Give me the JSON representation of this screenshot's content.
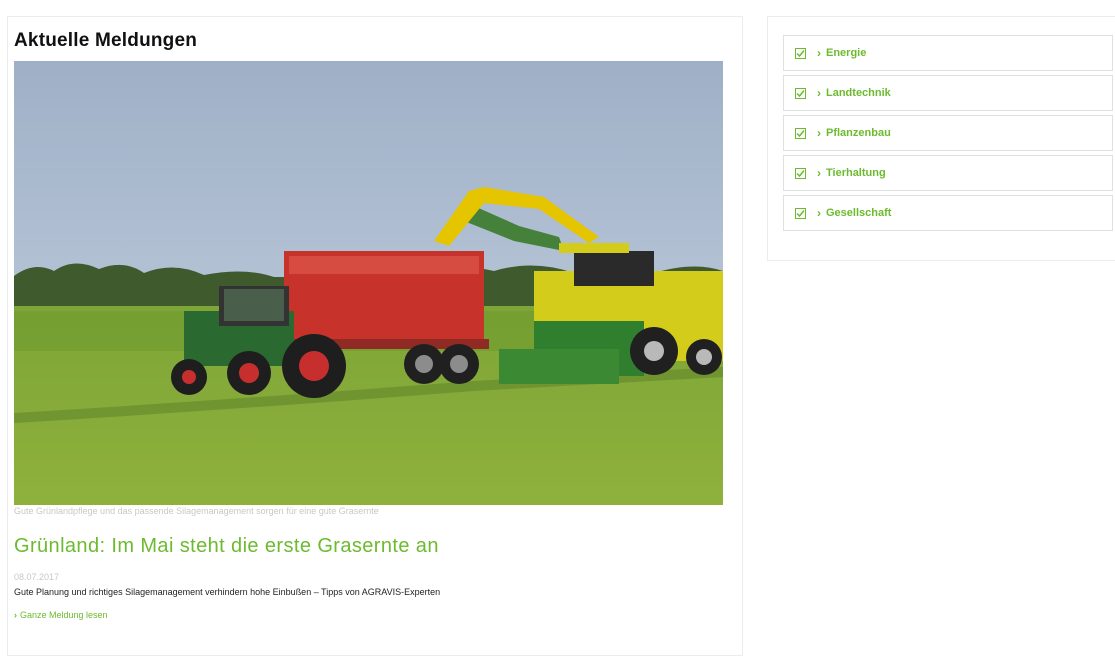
{
  "main": {
    "title": "Aktuelle Meldungen",
    "image_caption": "Gute Grünlandpflege und das passende Silagemanagement sorgen für eine gute Grasernte",
    "article": {
      "headline": "Grünland: Im Mai steht die erste Grasernte an",
      "date": "08.07.2017",
      "teaser": "Gute Planung und richtiges Silagemanagement verhindern hohe Einbußen – Tipps von AGRAVIS-Experten",
      "read_more": "Ganze Meldung lesen"
    }
  },
  "filters": {
    "items": [
      {
        "label": "Energie",
        "checked": true
      },
      {
        "label": "Landtechnik",
        "checked": true
      },
      {
        "label": "Pflanzenbau",
        "checked": true
      },
      {
        "label": "Tierhaltung",
        "checked": true
      },
      {
        "label": "Gesellschaft",
        "checked": true
      }
    ]
  },
  "colors": {
    "accent": "#6cbb2f",
    "caption": "#c8c8c8",
    "title": "#111111"
  },
  "icons": {
    "checkbox": "checkbox-checked-icon",
    "arrow": "chevron-right-icon"
  }
}
